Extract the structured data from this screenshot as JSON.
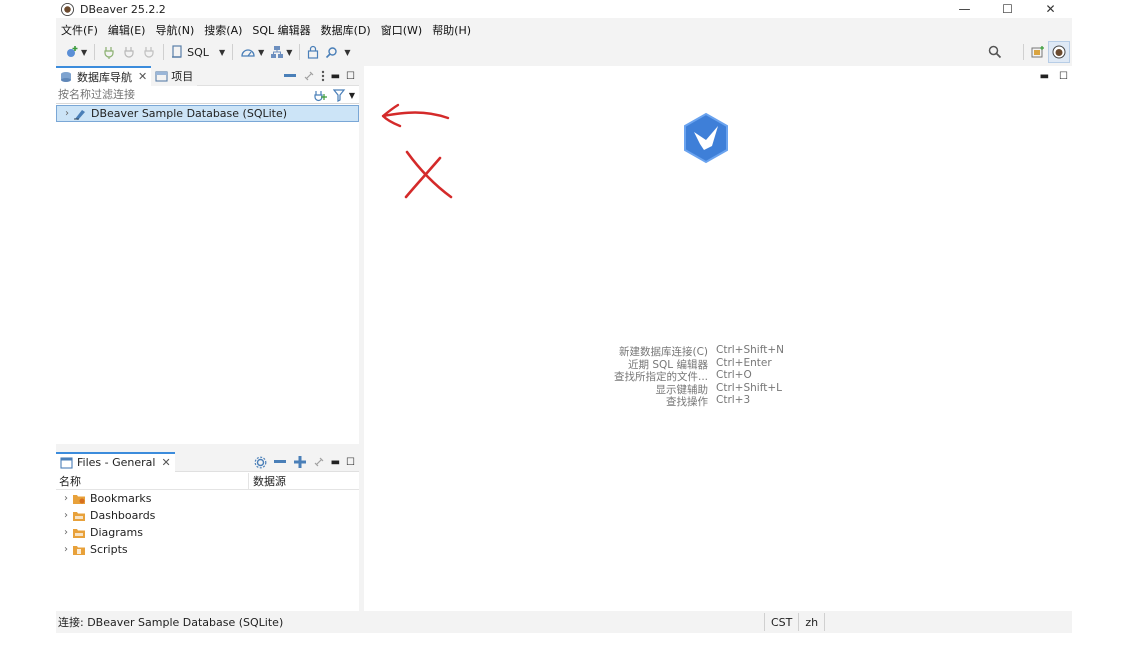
{
  "window": {
    "title": "DBeaver 25.2.2"
  },
  "menu": [
    "文件(F)",
    "编辑(E)",
    "导航(N)",
    "搜索(A)",
    "SQL 编辑器",
    "数据库(D)",
    "窗口(W)",
    "帮助(H)"
  ],
  "toolbar": {
    "sql_label": "SQL"
  },
  "navigator": {
    "tab_label": "数据库导航",
    "projects_tab_label": "项目",
    "filter_placeholder": "按名称过滤连接",
    "connections": [
      {
        "label": "DBeaver Sample Database (SQLite)"
      }
    ]
  },
  "files": {
    "tab_label": "Files - General",
    "columns": [
      "名称",
      "数据源"
    ],
    "items": [
      {
        "label": "Bookmarks",
        "icon": "bookmarks-folder-icon"
      },
      {
        "label": "Dashboards",
        "icon": "dashboards-folder-icon"
      },
      {
        "label": "Diagrams",
        "icon": "diagrams-folder-icon"
      },
      {
        "label": "Scripts",
        "icon": "scripts-folder-icon"
      }
    ]
  },
  "welcome": {
    "shortcuts": [
      {
        "label": "新建数据库连接(C)",
        "key": "Ctrl+Shift+N"
      },
      {
        "label": "近期 SQL 编辑器",
        "key": "Ctrl+Enter"
      },
      {
        "label": "查找所指定的文件...",
        "key": "Ctrl+O"
      },
      {
        "label": "显示键辅助",
        "key": "Ctrl+Shift+L"
      },
      {
        "label": "查找操作",
        "key": "Ctrl+3"
      }
    ]
  },
  "status": {
    "connection": "连接: DBeaver Sample Database (SQLite)",
    "timezone": "CST",
    "locale": "zh"
  },
  "colors": {
    "accent": "#3c8cdc",
    "logo_blue": "#3e7fd8",
    "annotation_red": "#d42a2a",
    "folder_orange": "#e8a13a"
  }
}
